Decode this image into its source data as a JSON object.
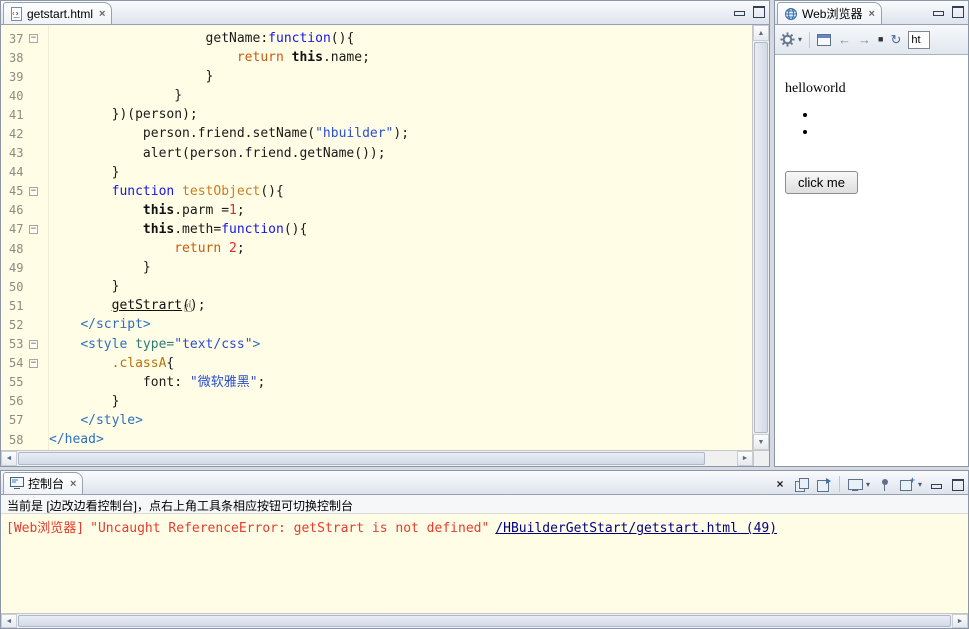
{
  "editor": {
    "tab_title": "getstart.html",
    "lines": [
      {
        "n": "37",
        "fold": true,
        "indent": 20,
        "tokens": [
          {
            "t": "getName:"
          },
          {
            "t": "function",
            "c": "kw"
          },
          {
            "t": "(){"
          }
        ]
      },
      {
        "n": "38",
        "indent": 24,
        "tokens": [
          {
            "t": "return",
            "c": "ret"
          },
          {
            "t": " "
          },
          {
            "t": "this",
            "c": "this"
          },
          {
            "t": ".name;"
          }
        ]
      },
      {
        "n": "39",
        "indent": 20,
        "tokens": [
          {
            "t": "}"
          }
        ]
      },
      {
        "n": "40",
        "indent": 16,
        "tokens": [
          {
            "t": "}"
          }
        ]
      },
      {
        "n": "41",
        "indent": 8,
        "tokens": [
          {
            "t": "})(person);"
          }
        ]
      },
      {
        "n": "42",
        "indent": 12,
        "tokens": [
          {
            "t": "person.friend.setName("
          },
          {
            "t": "\"hbuilder\"",
            "c": "str"
          },
          {
            "t": ");"
          }
        ]
      },
      {
        "n": "43",
        "indent": 12,
        "tokens": [
          {
            "t": "alert(person.friend.getName());"
          }
        ]
      },
      {
        "n": "44",
        "indent": 8,
        "tokens": [
          {
            "t": "}"
          }
        ]
      },
      {
        "n": "45",
        "fold": true,
        "indent": 8,
        "tokens": [
          {
            "t": "function",
            "c": "kw"
          },
          {
            "t": " "
          },
          {
            "t": "testObject",
            "c": "fn"
          },
          {
            "t": "(){"
          }
        ]
      },
      {
        "n": "46",
        "indent": 12,
        "tokens": [
          {
            "t": "this",
            "c": "this"
          },
          {
            "t": ".parm ="
          },
          {
            "t": "1",
            "c": "num"
          },
          {
            "t": ";"
          }
        ]
      },
      {
        "n": "47",
        "fold": true,
        "indent": 12,
        "tokens": [
          {
            "t": "this",
            "c": "this"
          },
          {
            "t": ".meth="
          },
          {
            "t": "function",
            "c": "kw"
          },
          {
            "t": "(){"
          }
        ]
      },
      {
        "n": "48",
        "indent": 16,
        "tokens": [
          {
            "t": "return",
            "c": "ret"
          },
          {
            "t": " "
          },
          {
            "t": "2",
            "c": "num"
          },
          {
            "t": ";"
          }
        ]
      },
      {
        "n": "49",
        "indent": 12,
        "tokens": [
          {
            "t": "}"
          }
        ]
      },
      {
        "n": "50",
        "indent": 8,
        "tokens": [
          {
            "t": "}"
          }
        ]
      },
      {
        "n": "51",
        "indent": 8,
        "tokens": [
          {
            "t": "getStrart",
            "c": "link"
          },
          {
            "t": "();"
          }
        ]
      },
      {
        "n": "52",
        "indent": 4,
        "tokens": [
          {
            "t": "</script>",
            "c": "tag"
          }
        ]
      },
      {
        "n": "53",
        "fold": true,
        "indent": 4,
        "tokens": [
          {
            "t": "<style",
            "c": "tag"
          },
          {
            "t": " "
          },
          {
            "t": "type=",
            "c": "attr"
          },
          {
            "t": "\"text/css\"",
            "c": "str"
          },
          {
            "t": ">",
            "c": "tag"
          }
        ]
      },
      {
        "n": "54",
        "fold": true,
        "indent": 8,
        "tokens": [
          {
            "t": ".classA",
            "c": "sel"
          },
          {
            "t": "{"
          }
        ]
      },
      {
        "n": "55",
        "indent": 12,
        "tokens": [
          {
            "t": "font: "
          },
          {
            "t": "\"微软雅黑\"",
            "c": "str"
          },
          {
            "t": ";"
          }
        ]
      },
      {
        "n": "56",
        "indent": 8,
        "tokens": [
          {
            "t": "}"
          }
        ]
      },
      {
        "n": "57",
        "indent": 4,
        "tokens": [
          {
            "t": "</style>",
            "c": "tag"
          }
        ]
      },
      {
        "n": "58",
        "indent": 0,
        "tokens": [
          {
            "t": "</head>",
            "c": "tag"
          }
        ]
      }
    ]
  },
  "browser": {
    "tab_title": "Web浏览器",
    "url_value": "ht",
    "content": {
      "heading": "helloworld",
      "button_label": "click me"
    }
  },
  "console": {
    "tab_title": "控制台",
    "info_text": "当前是 [边改边看控制台]，点右上角工具条相应按钮可切换控制台",
    "error_source": "[Web浏览器]",
    "error_message": "\"Uncaught ReferenceError: getStrart is not defined\"",
    "error_link": "/HBuilderGetStart/getstart.html (49)"
  },
  "icons": {
    "close": "×",
    "back": "←",
    "forward": "→",
    "stop": "■",
    "refresh": "↻",
    "caret": "▾",
    "hand": "☝",
    "scroll_up": "▲",
    "scroll_down": "▼",
    "scroll_left": "◄",
    "scroll_right": "►",
    "fold_minus": "−"
  },
  "colors": {
    "editor_background": "#FFFDE6",
    "error_red": "#E63C2F",
    "link_navy": "#000080"
  }
}
